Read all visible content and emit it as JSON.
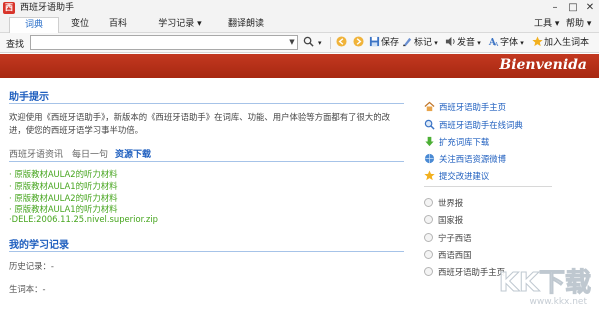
{
  "app": {
    "title": "西班牙语助手"
  },
  "menu": {
    "tabs": [
      "词典",
      "变位",
      "百科",
      "学习记录 ▾",
      "翻译朗读"
    ],
    "right": [
      "工具 ▾",
      "帮助 ▾"
    ]
  },
  "toolbar": {
    "label": "查找",
    "search_value": "",
    "save": "保存",
    "mark": "标记",
    "sound": "发音",
    "font": "字体",
    "add_vocab": "加入生词本"
  },
  "banner": {
    "text": "Bienvenida"
  },
  "main": {
    "tips_title": "助手提示",
    "tips_text": "欢迎使用《西班牙语助手》，新版本的《西班牙语助手》在词库、功能、用户体验等方面都有了很大的改进，使您的西班牙语学习事半功倍。",
    "subtabs": [
      "西班牙语资讯",
      "每日一句",
      "资源下载"
    ],
    "downloads": [
      "· 原版教材AULA2的听力材料",
      "· 原版教材AULA1的听力材料",
      "· 原版教材AULA2的听力材料",
      "· 原版教材AULA1的听力材料",
      "·DELE:2006.11.25.nivel.superior.zip"
    ],
    "record_title": "我的学习记录",
    "history": "历史记录：-",
    "vocab": "生词本：-"
  },
  "sidebar": {
    "links": [
      "西班牙语助手主页",
      "西班牙语助手在线词典",
      "扩充词库下载",
      "关注西语资源微博",
      "提交改进建议"
    ],
    "radios": [
      "世界报",
      "国家报",
      "宁子西语",
      "西语西国",
      "西班牙语助手主页"
    ]
  },
  "watermark": {
    "text": "KK下载",
    "url": "www.kkx.net"
  }
}
